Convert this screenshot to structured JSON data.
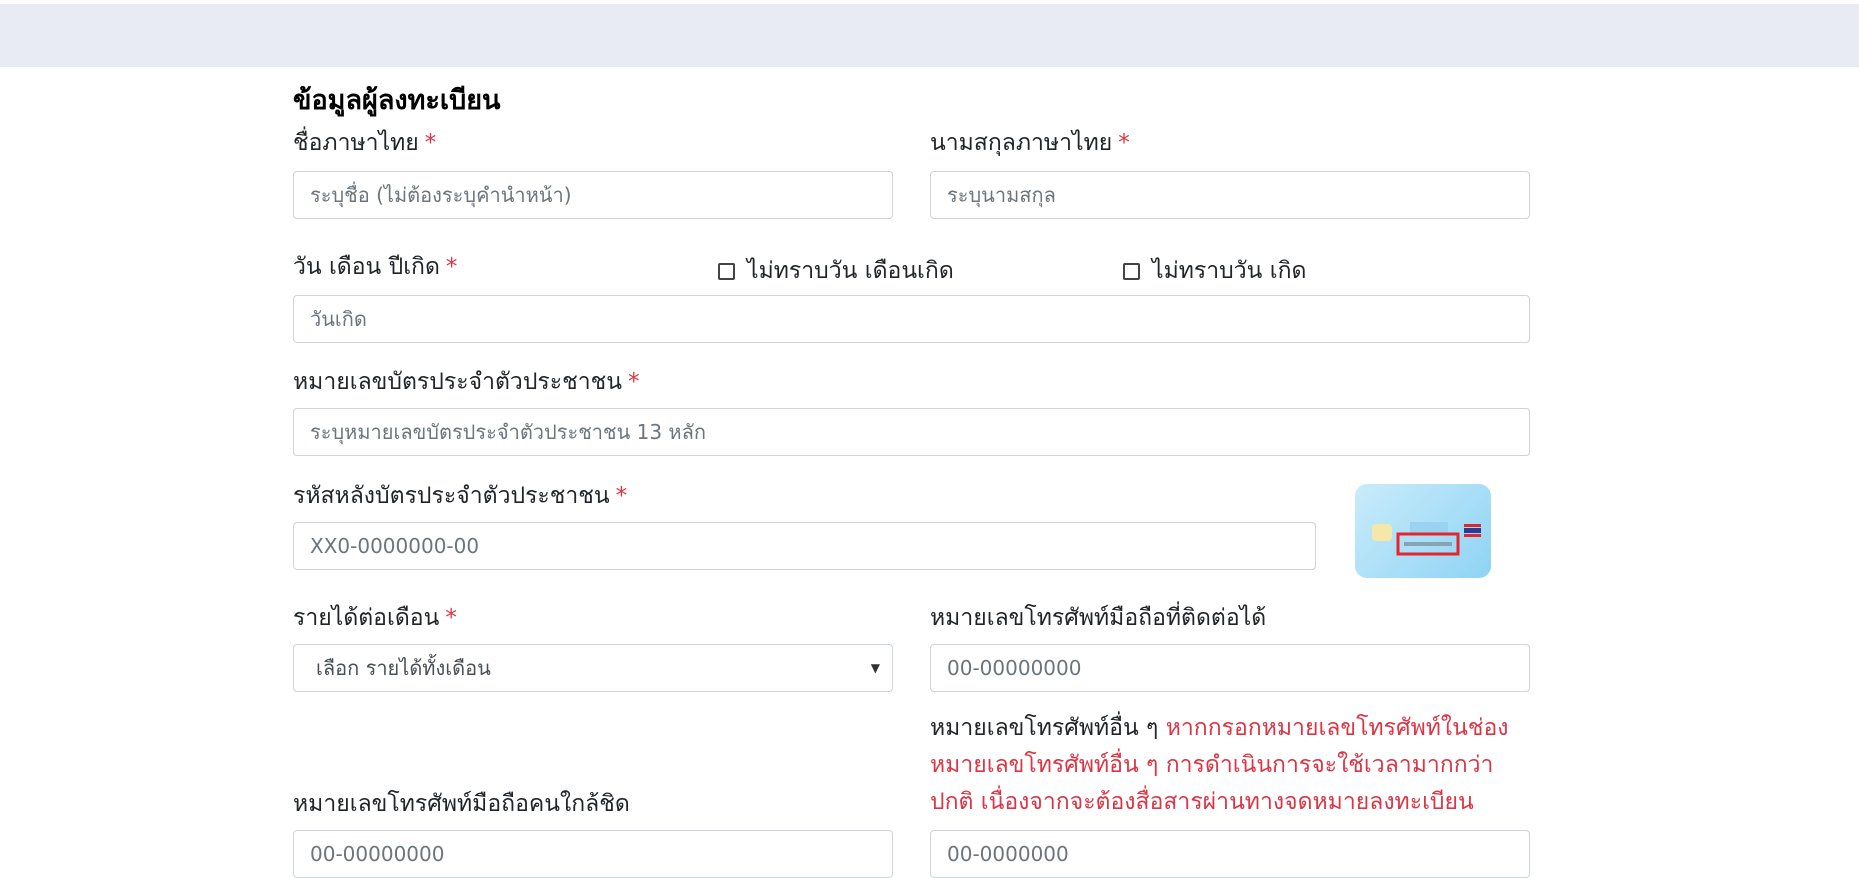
{
  "header": {
    "bar_color": "#e9ebf4"
  },
  "form": {
    "title": "ข้อมูลผู้ลงทะเบียน",
    "required_mark": "*",
    "first_name": {
      "label": "ชื่อภาษาไทย",
      "placeholder": "ระบุชื่อ (ไม่ต้องระบุคำนำหน้า)",
      "value": ""
    },
    "last_name": {
      "label": "นามสกุลภาษาไทย",
      "placeholder": "ระบุนามสกุล",
      "value": ""
    },
    "birth_date": {
      "label": "วัน เดือน ปีเกิด",
      "placeholder": "วันเกิด",
      "unknown_day_month_label": "ไม่ทราบวัน เดือนเกิด",
      "unknown_day_label": "ไม่ทราบวัน เกิด",
      "unknown_day_month_checked": false,
      "unknown_day_checked": false
    },
    "citizen_id": {
      "label": "หมายเลขบัตรประจำตัวประชาชน",
      "placeholder": "ระบุหมายเลขบัตรประจำตัวประชาชน 13 หลัก"
    },
    "laser_code": {
      "label": "รหัสหลังบัตรประจำตัวประชาชน",
      "placeholder": "XX0-0000000-00",
      "thumbnail_icon": "id-card-back-icon"
    },
    "income": {
      "label": "รายได้ต่อเดือน",
      "selected": "เลือก รายได้ทั้งเดือน"
    },
    "mobile": {
      "label": "หมายเลขโทรศัพท์มือถือที่ติดต่อได้",
      "placeholder": "00-00000000"
    },
    "close_contact_mobile": {
      "label": "หมายเลขโทรศัพท์มือถือคนใกล้ชิด",
      "placeholder": "00-00000000"
    },
    "other_phone": {
      "label": "หมายเลขโทรศัพท์อื่น ๆ",
      "warning": "หากกรอกหมายเลขโทรศัพท์ในช่องหมายเลขโทรศัพท์อื่น ๆ การดำเนินการจะใช้เวลามากกว่าปกติ เนื่องจากจะต้องสื่อสารผ่านทางจดหมายลงทะเบียน",
      "placeholder": "00-0000000"
    }
  },
  "colors": {
    "required": "#dc3545",
    "warning": "#dc3545",
    "input_border": "#ced4da"
  }
}
